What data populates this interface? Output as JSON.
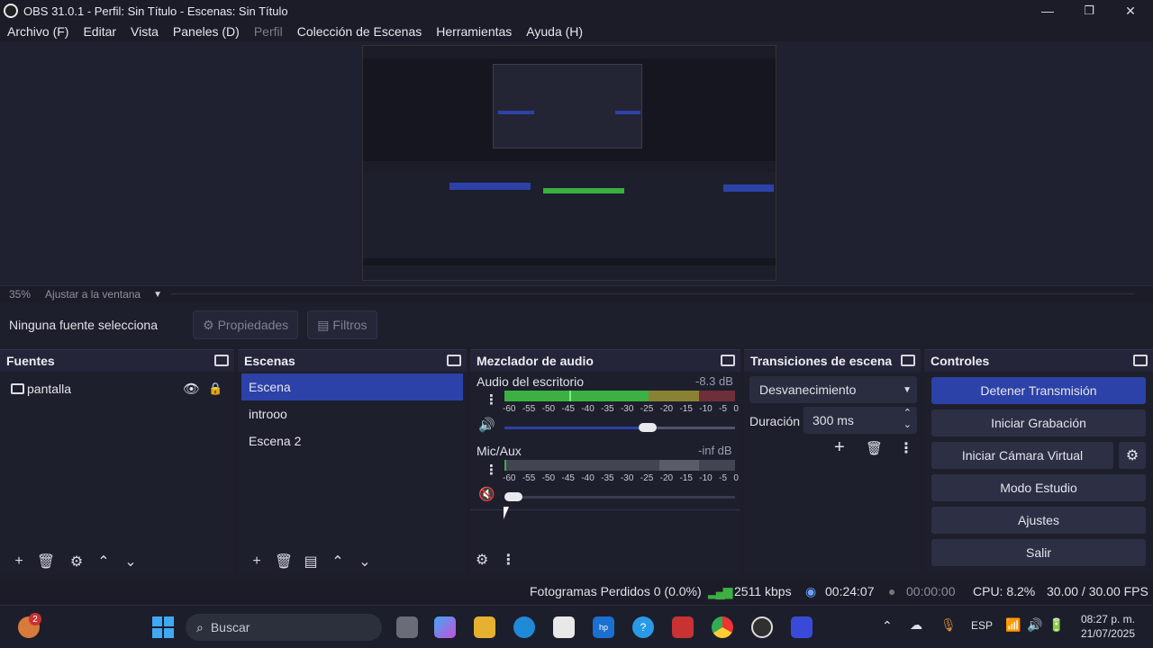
{
  "window": {
    "title": "OBS 31.0.1 - Perfil: Sin Título - Escenas: Sin Título",
    "minimize": "—",
    "maximize": "❐",
    "close": "✕"
  },
  "menu": [
    "Archivo (F)",
    "Editar",
    "Vista",
    "Paneles (D)",
    "Perfil",
    "Colección de Escenas",
    "Herramientas",
    "Ayuda (H)"
  ],
  "preview": {
    "zoom": "35%",
    "fit_label": "Ajustar a la ventana"
  },
  "source_toolbar": {
    "no_source": "Ninguna fuente selecciona",
    "properties": "Propiedades",
    "filters": "Filtros"
  },
  "sources": {
    "title": "Fuentes",
    "items": [
      {
        "label": "pantalla"
      }
    ]
  },
  "scenes": {
    "title": "Escenas",
    "items": [
      {
        "label": "Escena",
        "selected": true
      },
      {
        "label": "introoo",
        "selected": false
      },
      {
        "label": "Escena 2",
        "selected": false
      }
    ]
  },
  "mixer": {
    "title": "Mezclador de audio",
    "ticks": [
      "-60",
      "-55",
      "-50",
      "-45",
      "-40",
      "-35",
      "-30",
      "-25",
      "-20",
      "-15",
      "-10",
      "-5",
      "0"
    ],
    "channels": [
      {
        "name": "Audio del escritorio",
        "db": "-8.3 dB",
        "muted": false,
        "level": 0.62
      },
      {
        "name": "Mic/Aux",
        "db": "-inf dB",
        "muted": true,
        "level": 0.0
      }
    ]
  },
  "transitions": {
    "title": "Transiciones de escena",
    "selected": "Desvanecimiento",
    "duration_label": "Duración",
    "duration_value": "300 ms"
  },
  "controls": {
    "title": "Controles",
    "stop_stream": "Detener Transmisión",
    "start_recording": "Iniciar Grabación",
    "start_virtual_cam": "Iniciar Cámara Virtual",
    "studio_mode": "Modo Estudio",
    "settings": "Ajustes",
    "exit": "Salir"
  },
  "status": {
    "dropped_frames": "Fotogramas Perdidos 0 (0.0%)",
    "bitrate": "2511 kbps",
    "stream_time": "00:24:07",
    "rec_time": "00:00:00",
    "cpu": "CPU: 8.2%",
    "fps": "30.00 / 30.00 FPS"
  },
  "taskbar": {
    "search_placeholder": "Buscar",
    "lang": "ESP",
    "time": "08:27 p. m.",
    "date": "21/07/2025",
    "notif_count": "2"
  },
  "colors": {
    "accent": "#2c42a8",
    "meter_green": "#3cb043",
    "meter_yellow": "#c8b832",
    "meter_red": "#c8323c"
  }
}
